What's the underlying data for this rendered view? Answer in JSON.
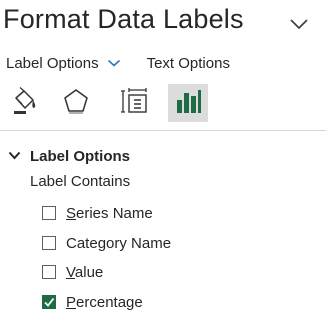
{
  "pane": {
    "title": "Format Data Labels",
    "collapse_icon": "chevron-down-icon"
  },
  "tabs": [
    {
      "label": "Label Options",
      "has_dropdown": true,
      "selected": true
    },
    {
      "label": "Text Options",
      "has_dropdown": false,
      "selected": false
    }
  ],
  "icon_tabs": [
    {
      "icon": "fill-line-icon",
      "active": false
    },
    {
      "icon": "effects-pentagon-icon",
      "active": false
    },
    {
      "icon": "size-properties-icon",
      "active": false
    },
    {
      "icon": "label-options-bar-chart-icon",
      "active": true
    }
  ],
  "section": {
    "title": "Label Options",
    "expanded": true,
    "subheading": "Label Contains",
    "options": [
      {
        "accel": "S",
        "rest": "eries Name",
        "checked": false
      },
      {
        "accel": "",
        "rest": "Category Name",
        "accel_inner": "g",
        "checked": false
      },
      {
        "accel": "V",
        "rest": "alue",
        "checked": false
      },
      {
        "accel": "P",
        "rest": "ercentage",
        "checked": true
      }
    ]
  },
  "colors": {
    "accent_green": "#1e6b45",
    "dropdown_blue": "#2b78c5",
    "active_tab_bg": "#dcdcdc"
  }
}
